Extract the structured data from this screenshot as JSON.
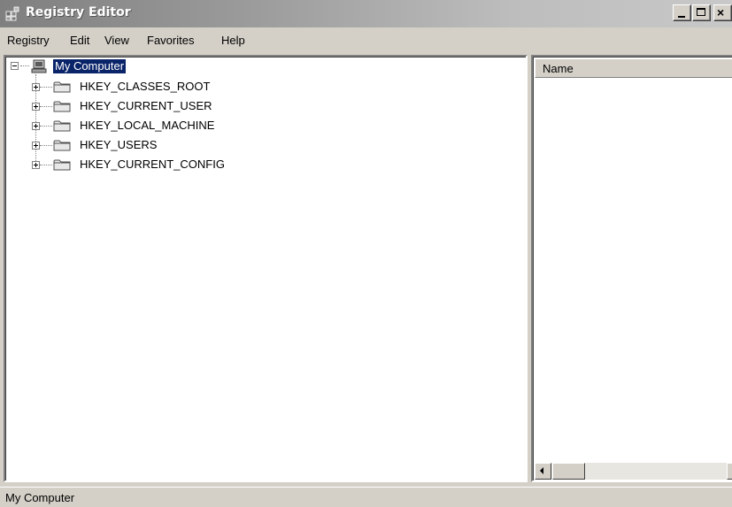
{
  "window": {
    "title": "Registry Editor",
    "caption_buttons": {
      "minimize": "minimize-icon",
      "maximize": "maximize-icon",
      "close": "close-icon",
      "close_glyph": "×"
    }
  },
  "menu": {
    "items": [
      {
        "label": "Registry"
      },
      {
        "label": "Edit"
      },
      {
        "label": "View"
      },
      {
        "label": "Favorites"
      },
      {
        "label": "Help"
      }
    ]
  },
  "tree": {
    "root": {
      "label": "My Computer",
      "icon": "computer-icon",
      "expanded": true,
      "selected": true
    },
    "keys": [
      {
        "label": "HKEY_CLASSES_ROOT",
        "icon": "folder-icon",
        "expanded": false
      },
      {
        "label": "HKEY_CURRENT_USER",
        "icon": "folder-icon",
        "expanded": false
      },
      {
        "label": "HKEY_LOCAL_MACHINE",
        "icon": "folder-icon",
        "expanded": false
      },
      {
        "label": "HKEY_USERS",
        "icon": "folder-icon",
        "expanded": false
      },
      {
        "label": "HKEY_CURRENT_CONFIG",
        "icon": "folder-icon",
        "expanded": false
      }
    ]
  },
  "list": {
    "columns": [
      {
        "label": "Name"
      }
    ]
  },
  "status": {
    "text": "My Computer"
  },
  "colors": {
    "selection": "#0a246a",
    "face": "#d4d0c8",
    "title_start": "#7f7f7f",
    "title_end": "#c8c8c8"
  }
}
